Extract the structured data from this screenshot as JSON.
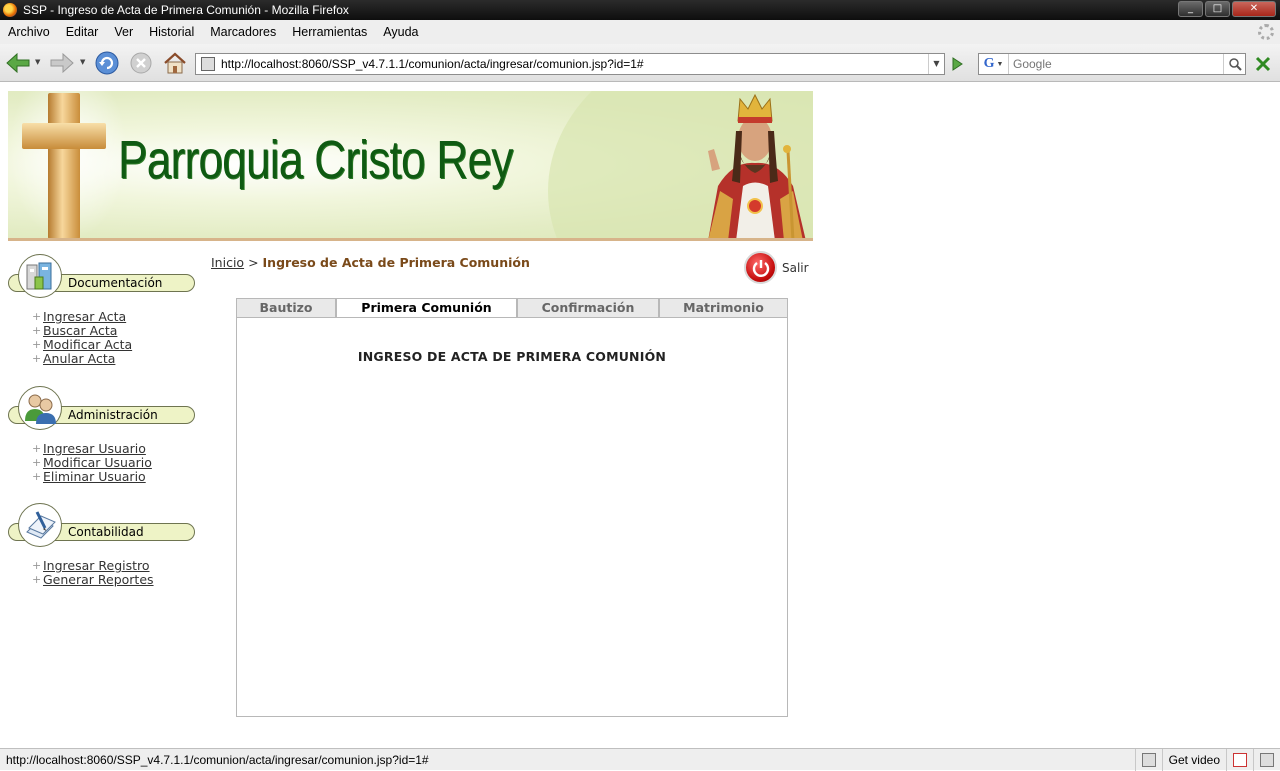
{
  "window": {
    "title": "SSP - Ingreso de Acta de Primera Comunión - Mozilla Firefox",
    "minimize": "_",
    "maximize": "□",
    "close": "✕"
  },
  "menubar": {
    "items": [
      "Archivo",
      "Editar",
      "Ver",
      "Historial",
      "Marcadores",
      "Herramientas",
      "Ayuda"
    ]
  },
  "toolbar": {
    "url": "http://localhost:8060/SSP_v4.7.1.1/comunion/acta/ingresar/comunion.jsp?id=1#",
    "search_placeholder": "Google",
    "search_engine_letter": "G"
  },
  "banner": {
    "site_title": "Parroquia Cristo Rey"
  },
  "sidebar": {
    "sections": [
      {
        "title": "Documentación",
        "links": [
          "Ingresar Acta",
          "Buscar Acta",
          "Modificar Acta",
          "Anular Acta"
        ]
      },
      {
        "title": "Administración",
        "links": [
          "Ingresar Usuario",
          "Modificar Usuario",
          "Eliminar Usuario"
        ]
      },
      {
        "title": "Contabilidad",
        "links": [
          "Ingresar Registro",
          "Generar Reportes"
        ]
      }
    ]
  },
  "breadcrumb": {
    "home": "Inicio",
    "separator": ">",
    "current": "Ingreso de Acta de Primera Comunión"
  },
  "logout": {
    "label": "Salir"
  },
  "tabs": [
    {
      "label": "Bautizo",
      "active": false
    },
    {
      "label": "Primera Comunión",
      "active": true
    },
    {
      "label": "Confirmación",
      "active": false
    },
    {
      "label": "Matrimonio",
      "active": false
    }
  ],
  "panel": {
    "title": "INGRESO DE ACTA DE PRIMERA COMUNIÓN"
  },
  "statusbar": {
    "text": "http://localhost:8060/SSP_v4.7.1.1/comunion/acta/ingresar/comunion.jsp?id=1#",
    "video_label": "Get video"
  }
}
